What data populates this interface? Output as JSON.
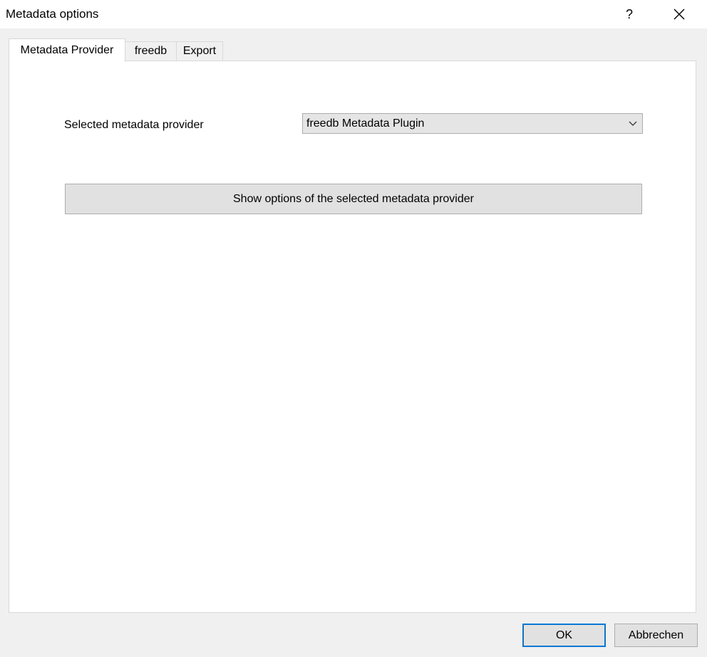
{
  "window": {
    "title": "Metadata options",
    "help_label": "?"
  },
  "tabs": [
    {
      "label": "Metadata Provider",
      "active": true
    },
    {
      "label": "freedb",
      "active": false
    },
    {
      "label": "Export",
      "active": false
    }
  ],
  "provider": {
    "label": "Selected metadata provider",
    "selected_value": "freedb Metadata Plugin"
  },
  "options_button_label": "Show options of the selected metadata provider",
  "footer": {
    "ok_label": "OK",
    "cancel_label": "Abbrechen"
  },
  "icons": {
    "close": "close-icon",
    "dropdown": "chevron-down-icon"
  },
  "colors": {
    "focus_border": "#0078d7"
  }
}
